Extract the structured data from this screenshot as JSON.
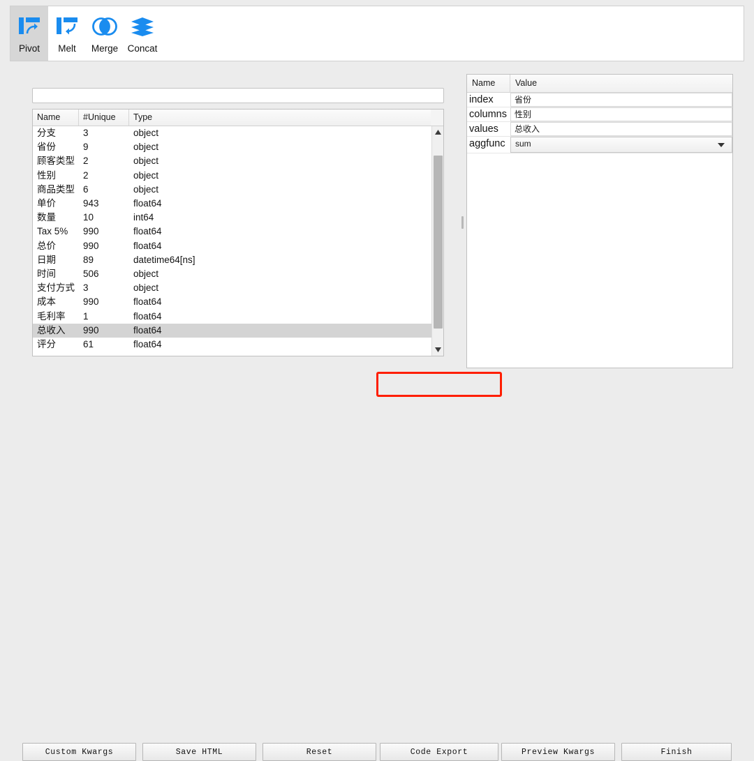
{
  "ribbon": {
    "items": [
      {
        "label": "Pivot",
        "icon": "pivot-icon",
        "selected": true
      },
      {
        "label": "Melt",
        "icon": "melt-icon",
        "selected": false
      },
      {
        "label": "Merge",
        "icon": "merge-icon",
        "selected": false
      },
      {
        "label": "Concat",
        "icon": "concat-icon",
        "selected": false
      }
    ],
    "accent_color": "#1a8cef"
  },
  "left_panel": {
    "filter": {
      "value": "",
      "placeholder": ""
    },
    "table": {
      "columns": [
        "Name",
        "#Unique",
        "Type"
      ],
      "rows": [
        {
          "name": "分支",
          "unique": "3",
          "type": "object",
          "selected": false
        },
        {
          "name": "省份",
          "unique": "9",
          "type": "object",
          "selected": false
        },
        {
          "name": "顾客类型",
          "unique": "2",
          "type": "object",
          "selected": false
        },
        {
          "name": "性别",
          "unique": "2",
          "type": "object",
          "selected": false
        },
        {
          "name": "商品类型",
          "unique": "6",
          "type": "object",
          "selected": false
        },
        {
          "name": "单价",
          "unique": "943",
          "type": "float64",
          "selected": false
        },
        {
          "name": "数量",
          "unique": "10",
          "type": "int64",
          "selected": false
        },
        {
          "name": "Tax 5%",
          "unique": "990",
          "type": "float64",
          "selected": false
        },
        {
          "name": "总价",
          "unique": "990",
          "type": "float64",
          "selected": false
        },
        {
          "name": "日期",
          "unique": "89",
          "type": "datetime64[ns]",
          "selected": false
        },
        {
          "name": "时间",
          "unique": "506",
          "type": "object",
          "selected": false
        },
        {
          "name": "支付方式",
          "unique": "3",
          "type": "object",
          "selected": false
        },
        {
          "name": "成本",
          "unique": "990",
          "type": "float64",
          "selected": false
        },
        {
          "name": "毛利率",
          "unique": "1",
          "type": "float64",
          "selected": false
        },
        {
          "name": "总收入",
          "unique": "990",
          "type": "float64",
          "selected": true
        },
        {
          "name": "评分",
          "unique": "61",
          "type": "float64",
          "selected": false
        }
      ]
    },
    "scrollbar": {
      "up_icon": "scroll-up-arrow-icon",
      "down_icon": "scroll-down-arrow-icon"
    }
  },
  "right_panel": {
    "columns": [
      "Name",
      "Value"
    ],
    "rows": [
      {
        "name": "index",
        "value": "省份",
        "widget": "text"
      },
      {
        "name": "columns",
        "value": "性别",
        "widget": "text"
      },
      {
        "name": "values",
        "value": "总收入",
        "widget": "text"
      },
      {
        "name": "aggfunc",
        "value": "sum",
        "widget": "combobox"
      }
    ]
  },
  "buttons": [
    {
      "label": "Custom Kwargs",
      "highlighted": false
    },
    {
      "label": "Save HTML",
      "highlighted": false
    },
    {
      "label": "Reset",
      "highlighted": false
    },
    {
      "label": "Code Export",
      "highlighted": true
    },
    {
      "label": "Preview Kwargs",
      "highlighted": false
    },
    {
      "label": "Finish",
      "highlighted": false
    }
  ],
  "highlight": {
    "color": "#ff1e00"
  }
}
